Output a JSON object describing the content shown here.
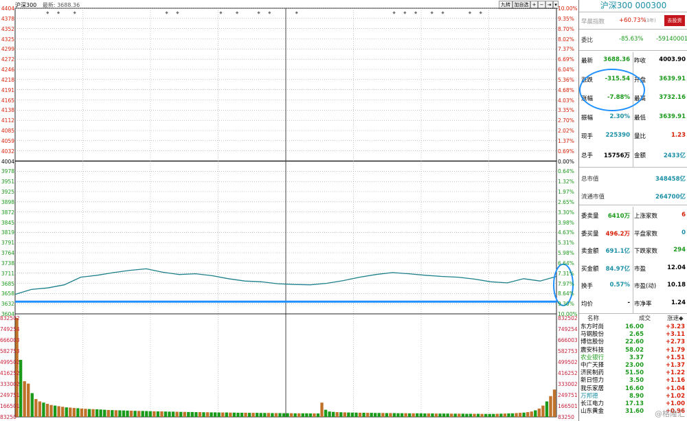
{
  "header": {
    "index_name": "沪深300",
    "latest_label": "最新",
    "latest_value": "3688.36",
    "buttons": [
      "九转",
      "加自选",
      "+",
      "−",
      "⇥",
      "▾"
    ]
  },
  "chart_data": {
    "type": "line",
    "title": "沪深300",
    "price_ticks": [
      "4404",
      "4378",
      "4352",
      "4325",
      "4299",
      "4272",
      "4246",
      "4218",
      "4191",
      "4165",
      "4138",
      "4112",
      "4085",
      "4059",
      "4032",
      "4004",
      "3978",
      "3951",
      "3925",
      "3898",
      "3872",
      "3845",
      "3819",
      "3791",
      "3764",
      "3738",
      "3711",
      "3685",
      "3658",
      "3632",
      "3604"
    ],
    "pct_ticks": [
      "10.00%",
      "9.35%",
      "8.70%",
      "8.02%",
      "7.37%",
      "6.69%",
      "6.04%",
      "5.36%",
      "4.68%",
      "4.03%",
      "3.35%",
      "2.70%",
      "2.02%",
      "1.37%",
      "0.69%",
      "0.00%",
      "0.64%",
      "1.32%",
      "1.97%",
      "2.65%",
      "3.30%",
      "3.98%",
      "4.63%",
      "5.31%",
      "5.98%",
      "6.64%",
      "7.31%",
      "7.97%",
      "8.64%",
      "9.30%",
      "10.00%"
    ],
    "ylim": [
      3604,
      4404
    ],
    "prev_close": 4003.9,
    "x_minutes": [
      0,
      8,
      16,
      24,
      32,
      40,
      48,
      56,
      64,
      72,
      80,
      88,
      96,
      104,
      112,
      120,
      128,
      136,
      144,
      152,
      160,
      168,
      176,
      184,
      192,
      200,
      208,
      216,
      224,
      232,
      240
    ],
    "price_series": [
      3655,
      3668,
      3672,
      3680,
      3700,
      3705,
      3712,
      3718,
      3722,
      3713,
      3707,
      3709,
      3704,
      3696,
      3690,
      3688,
      3683,
      3681,
      3680,
      3684,
      3691,
      3700,
      3707,
      3712,
      3709,
      3705,
      3702,
      3700,
      3695,
      3688,
      3685,
      3696,
      3690,
      3702
    ],
    "volume_ticks": [
      "832502",
      "749254",
      "666003",
      "582753",
      "499502",
      "416252",
      "333002",
      "249751",
      "166501",
      "83250"
    ],
    "volume_ylim": [
      0,
      832502
    ],
    "volume_values": [
      832502,
      480000,
      300000,
      280000,
      200000,
      150000,
      130000,
      120000,
      110000,
      100000,
      95000,
      90000,
      85000,
      80000,
      78000,
      75000,
      73000,
      70000,
      68000,
      66000,
      65000,
      64000,
      62000,
      60000,
      58000,
      57000,
      56000,
      55000,
      54000,
      53000,
      52000,
      51000,
      50000,
      50000,
      49000,
      48000,
      47000,
      46000,
      46000,
      45000,
      44000,
      44000,
      43000,
      42000,
      42000,
      41000,
      41000,
      40000,
      40000,
      39000,
      39000,
      38000,
      38000,
      37000,
      37000,
      37000,
      36000,
      36000,
      35000,
      35000,
      35000,
      34000,
      34000,
      34000,
      33000,
      33000,
      33000,
      32000,
      32000,
      32000,
      31000,
      31000,
      31000,
      30000,
      30000,
      30000,
      30000,
      29000,
      29000,
      29000,
      120000,
      60000,
      45000,
      42000,
      40000,
      39000,
      38000,
      37000,
      36000,
      36000,
      35000,
      35000,
      34000,
      34000,
      33000,
      33000,
      33000,
      32000,
      32000,
      32000,
      31000,
      31000,
      31000,
      30000,
      30000,
      30000,
      30000,
      29000,
      29000,
      29000,
      28000,
      28000,
      28000,
      28000,
      27000,
      27000,
      27000,
      27000,
      26000,
      26000,
      26000,
      26000,
      25000,
      25000,
      25000,
      25000,
      26000,
      27000,
      28000,
      29000,
      30000,
      32000,
      34000,
      36000,
      40000,
      45000,
      55000,
      70000,
      95000,
      130000,
      175000,
      230000
    ],
    "top_markers": [
      0.06,
      0.08,
      0.11,
      0.28,
      0.3,
      0.38,
      0.41,
      0.45,
      0.47,
      0.52,
      0.7,
      0.72,
      0.74,
      0.77,
      0.79,
      0.84,
      0.86
    ]
  },
  "panel": {
    "title": "沪深300 000300",
    "tracking_label": "早晨指数",
    "tracking_value": "+60.73%",
    "tracking_note": "(3年)",
    "invest_button": "去投资",
    "weibi_label": "委比",
    "weibi_pct": "-85.63%",
    "weibi_diff": "-59140001",
    "quote_rows": [
      {
        "l1": "最新",
        "v1": "3688.36",
        "l2": "昨收",
        "v2": "4003.90",
        "c1": "green",
        "c2": "blk"
      },
      {
        "l1": "涨跌",
        "v1": "-315.54",
        "l2": "开盘",
        "v2": "3639.91",
        "c1": "green",
        "c2": "green"
      },
      {
        "l1": "涨幅",
        "v1": "-7.88%",
        "l2": "最高",
        "v2": "3732.16",
        "c1": "green",
        "c2": "green"
      },
      {
        "l1": "振幅",
        "v1": "2.30%",
        "l2": "最低",
        "v2": "3639.91",
        "c1": "teal",
        "c2": "green"
      },
      {
        "l1": "现手",
        "v1": "225390",
        "l2": "量比",
        "v2": "1.23",
        "c1": "teal",
        "c2": "red"
      },
      {
        "l1": "总手",
        "v1": "15756万",
        "l2": "金额",
        "v2": "2433亿",
        "c1": "blk",
        "c2": "teal"
      }
    ],
    "market_rows": [
      {
        "label": "总市值",
        "value": "348458亿"
      },
      {
        "label": "流通市值",
        "value": "264700亿"
      }
    ],
    "stat_rows": [
      {
        "l1": "委卖量",
        "v1": "6410万",
        "l2": "上涨家数",
        "v2": "6",
        "c1": "green",
        "c2": "red"
      },
      {
        "l1": "委买量",
        "v1": "496.2万",
        "l2": "平盘家数",
        "v2": "0",
        "c1": "red",
        "c2": "teal"
      },
      {
        "l1": "卖金额",
        "v1": "691.1亿",
        "l2": "下跌家数",
        "v2": "294",
        "c1": "teal",
        "c2": "green"
      },
      {
        "l1": "买金额",
        "v1": "84.97亿",
        "l2": "市盈",
        "v2": "12.04",
        "c1": "teal",
        "c2": "blk"
      },
      {
        "l1": "换手",
        "v1": "0.57%",
        "l2": "市盈(动)",
        "v2": "10.18",
        "c1": "teal",
        "c2": "blk"
      },
      {
        "l1": "均价",
        "v1": "-",
        "l2": "市净率",
        "v2": "1.24",
        "c1": "blk",
        "c2": "blk"
      }
    ],
    "stock_headers": [
      "名称",
      "成交",
      "涨速◆"
    ],
    "stocks": [
      {
        "name": "东方时尚",
        "price": "16.00",
        "speed": "+3.23",
        "nc": "blk"
      },
      {
        "name": "马钢股份",
        "price": "2.65",
        "speed": "+3.11",
        "nc": "blk"
      },
      {
        "name": "博信股份",
        "price": "22.60",
        "speed": "+2.73",
        "nc": "blk"
      },
      {
        "name": "震安科技",
        "price": "58.02",
        "speed": "+1.79",
        "nc": "blk"
      },
      {
        "name": "农业银行",
        "price": "3.37",
        "speed": "+1.51",
        "nc": "green"
      },
      {
        "name": "中广天择",
        "price": "23.00",
        "speed": "+1.37",
        "nc": "blk"
      },
      {
        "name": "济民制药",
        "price": "51.50",
        "speed": "+1.22",
        "nc": "blk"
      },
      {
        "name": "新日恒力",
        "price": "3.50",
        "speed": "+1.16",
        "nc": "blk"
      },
      {
        "name": "我乐家居",
        "price": "16.60",
        "speed": "+1.04",
        "nc": "blk"
      },
      {
        "name": "万邦德",
        "price": "8.90",
        "speed": "+1.02",
        "nc": "teal"
      },
      {
        "name": "长江电力",
        "price": "17.13",
        "speed": "+1.00",
        "nc": "blk"
      },
      {
        "name": "山东黄金",
        "price": "31.60",
        "speed": "+0.96",
        "nc": "blk"
      }
    ],
    "watermark": "@格隆汇"
  },
  "colors": {
    "up": "#d81e06",
    "down": "#1a9a1a",
    "line": "#1a7f8a",
    "highlight": "#1e90ff"
  }
}
